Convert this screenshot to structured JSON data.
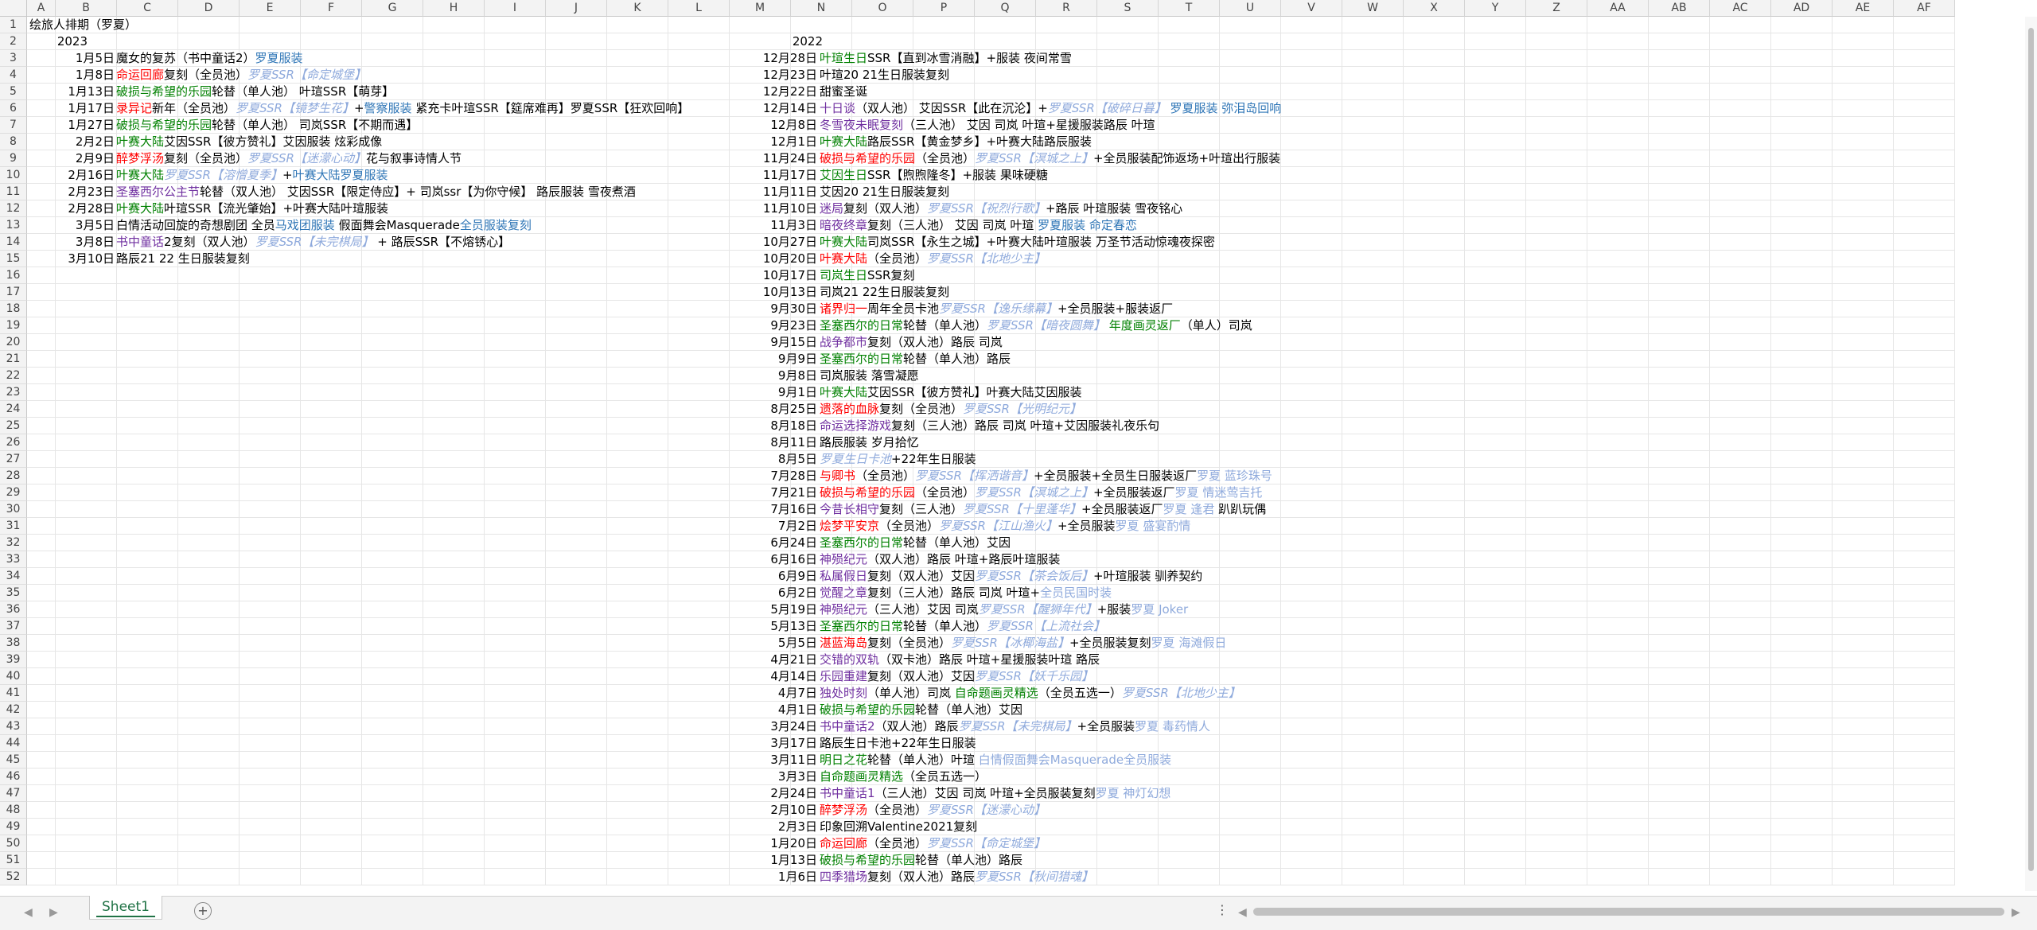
{
  "columns": [
    "A",
    "B",
    "C",
    "D",
    "E",
    "F",
    "G",
    "H",
    "I",
    "J",
    "K",
    "L",
    "M",
    "N",
    "O",
    "P",
    "Q",
    "R",
    "S",
    "T",
    "U",
    "V",
    "W",
    "X",
    "Y",
    "Z",
    "AA",
    "AB",
    "AC",
    "AD",
    "AE",
    "AF"
  ],
  "sheet_tab": "Sheet1",
  "add_sheet": "+",
  "more": "⋮",
  "colors": {
    "red": "#ff0000",
    "green": "#008000",
    "purple": "#7030a0",
    "blue": "#2e75b6",
    "lightblue": "#8faadc",
    "black": "#000000"
  },
  "title": [
    {
      "t": "绘旅人排期（罗夏）",
      "c": "black"
    }
  ],
  "left_year": "2023",
  "right_year": "2022",
  "left": [
    {
      "row": 3,
      "date": "1月5日",
      "segs": [
        {
          "t": "魔女的复苏（书中童话2）",
          "c": "black"
        },
        {
          "t": "罗夏服装",
          "c": "blue"
        }
      ]
    },
    {
      "row": 4,
      "date": "1月8日",
      "segs": [
        {
          "t": "命运回廊",
          "c": "red"
        },
        {
          "t": "复刻（全员池）",
          "c": "black"
        },
        {
          "t": "罗夏SSR【命定城堡】",
          "c": "lightblue",
          "i": true
        }
      ]
    },
    {
      "row": 5,
      "date": "1月13日",
      "segs": [
        {
          "t": "破损与希望的乐园",
          "c": "green"
        },
        {
          "t": "轮替（单人池） 叶瑄SSR【萌芽】",
          "c": "black"
        }
      ]
    },
    {
      "row": 6,
      "date": "1月17日",
      "segs": [
        {
          "t": "录异记",
          "c": "red"
        },
        {
          "t": "新年（全员池）",
          "c": "black"
        },
        {
          "t": "罗夏SSR【镜梦生花】",
          "c": "lightblue",
          "i": true
        },
        {
          "t": "+",
          "c": "black"
        },
        {
          "t": "警察服装",
          "c": "blue"
        },
        {
          "t": "    紧充卡叶瑄SSR【筵席难再】罗夏SSR【狂欢回响】",
          "c": "black"
        }
      ]
    },
    {
      "row": 7,
      "date": "1月27日",
      "segs": [
        {
          "t": "破损与希望的乐园",
          "c": "green"
        },
        {
          "t": "轮替（单人池） 司岚SSR【不期而遇】",
          "c": "black"
        }
      ]
    },
    {
      "row": 8,
      "date": "2月2日",
      "segs": [
        {
          "t": "叶赛大陆",
          "c": "green"
        },
        {
          "t": "艾因SSR【彼方赞礼】艾因服装 炫彩成像",
          "c": "black"
        }
      ]
    },
    {
      "row": 9,
      "date": "2月9日",
      "segs": [
        {
          "t": "醉梦浮汤",
          "c": "red"
        },
        {
          "t": "复刻（全员池）",
          "c": "black"
        },
        {
          "t": "罗夏SSR【迷濛心动】",
          "c": "lightblue",
          "i": true
        },
        {
          "t": "花与叙事诗情人节",
          "c": "black"
        }
      ]
    },
    {
      "row": 10,
      "date": "2月16日",
      "segs": [
        {
          "t": "叶赛大陆",
          "c": "green"
        },
        {
          "t": "罗夏SSR【溶憎夏季】",
          "c": "lightblue",
          "i": true
        },
        {
          "t": "+",
          "c": "black"
        },
        {
          "t": "叶赛大陆罗夏服装",
          "c": "blue"
        }
      ]
    },
    {
      "row": 11,
      "date": "2月23日",
      "segs": [
        {
          "t": "圣塞西尔公主节",
          "c": "purple"
        },
        {
          "t": "轮替（双人池） 艾因SSR【限定侍应】+ 司岚ssr【为你守候】  路辰服装 雪夜煮酒",
          "c": "black"
        }
      ]
    },
    {
      "row": 12,
      "date": "2月28日",
      "segs": [
        {
          "t": "叶赛大陆",
          "c": "green"
        },
        {
          "t": "叶瑄SSR【流光肇始】+叶赛大陆叶瑄服装",
          "c": "black"
        }
      ]
    },
    {
      "row": 13,
      "date": "3月5日",
      "segs": [
        {
          "t": "白情活动回旋的奇想剧团 全员",
          "c": "black"
        },
        {
          "t": "马戏团服装",
          "c": "blue"
        },
        {
          "t": "  假面舞会Masquerade",
          "c": "black"
        },
        {
          "t": "全员服装复刻",
          "c": "blue"
        }
      ]
    },
    {
      "row": 14,
      "date": "3月8日",
      "segs": [
        {
          "t": "书中童话",
          "c": "purple"
        },
        {
          "t": "2复刻（双人池）",
          "c": "black"
        },
        {
          "t": "罗夏SSR【未完棋局】",
          "c": "lightblue",
          "i": true
        },
        {
          "t": " + 路辰SSR【不熔锈心】",
          "c": "black"
        }
      ]
    },
    {
      "row": 15,
      "date": "3月10日",
      "segs": [
        {
          "t": "路辰21 22 生日服装复刻",
          "c": "black"
        }
      ]
    }
  ],
  "right": [
    {
      "row": 3,
      "date": "12月28日",
      "segs": [
        {
          "t": "叶瑄生日",
          "c": "green"
        },
        {
          "t": "SSR【直到冰雪消融】+服装 夜间常雪",
          "c": "black"
        }
      ]
    },
    {
      "row": 4,
      "date": "12月23日",
      "segs": [
        {
          "t": "叶瑄20 21生日服装复刻",
          "c": "black"
        }
      ]
    },
    {
      "row": 5,
      "date": "12月22日",
      "segs": [
        {
          "t": "甜蜜圣诞",
          "c": "black"
        }
      ]
    },
    {
      "row": 6,
      "date": "12月14日",
      "segs": [
        {
          "t": "十日谈",
          "c": "purple"
        },
        {
          "t": "（双人池） 艾因SSR【此在沉沦】+",
          "c": "black"
        },
        {
          "t": "罗夏SSR【破碎日暮】",
          "c": "lightblue",
          "i": true
        },
        {
          "t": "  罗夏服装 弥泪岛回响",
          "c": "blue"
        }
      ]
    },
    {
      "row": 7,
      "date": "12月8日",
      "segs": [
        {
          "t": "冬雪夜未眠复刻",
          "c": "purple"
        },
        {
          "t": "（三人池） 艾因 司岚 叶瑄+星援服装路辰 叶瑄",
          "c": "black"
        }
      ]
    },
    {
      "row": 8,
      "date": "12月1日",
      "segs": [
        {
          "t": "叶赛大陆",
          "c": "green"
        },
        {
          "t": "路辰SSR【黄金梦乡】+叶赛大陆路辰服装",
          "c": "black"
        }
      ]
    },
    {
      "row": 9,
      "date": "11月24日",
      "segs": [
        {
          "t": "破损与希望的乐园",
          "c": "red"
        },
        {
          "t": "（全员池）",
          "c": "black"
        },
        {
          "t": "罗夏SSR【溟城之上】",
          "c": "lightblue",
          "i": true
        },
        {
          "t": "+全员服装配饰返场+叶瑄出行服装",
          "c": "black"
        }
      ]
    },
    {
      "row": 10,
      "date": "11月17日",
      "segs": [
        {
          "t": "艾因生日",
          "c": "green"
        },
        {
          "t": "SSR【煦煦隆冬】+服装 果味硬糖",
          "c": "black"
        }
      ]
    },
    {
      "row": 11,
      "date": "11月11日",
      "segs": [
        {
          "t": "艾因20 21生日服装复刻",
          "c": "black"
        }
      ]
    },
    {
      "row": 12,
      "date": "11月10日",
      "segs": [
        {
          "t": "迷局",
          "c": "purple"
        },
        {
          "t": "复刻（双人池）",
          "c": "black"
        },
        {
          "t": "罗夏SSR【祝烈行歌】",
          "c": "lightblue",
          "i": true
        },
        {
          "t": "+路辰  叶瑄服装 雪夜铭心",
          "c": "black"
        }
      ]
    },
    {
      "row": 13,
      "date": "11月3日",
      "segs": [
        {
          "t": "暗夜终章",
          "c": "purple"
        },
        {
          "t": "复刻（三人池） 艾因 司岚 叶瑄  ",
          "c": "black"
        },
        {
          "t": "罗夏服装 命定春恋",
          "c": "blue"
        }
      ]
    },
    {
      "row": 14,
      "date": "10月27日",
      "segs": [
        {
          "t": "叶赛大陆",
          "c": "green"
        },
        {
          "t": "司岚SSR【永生之城】+叶赛大陆叶瑄服装 万圣节活动惊魂夜探密",
          "c": "black"
        }
      ]
    },
    {
      "row": 15,
      "date": "10月20日",
      "segs": [
        {
          "t": "叶赛大陆",
          "c": "red"
        },
        {
          "t": "（全员池）",
          "c": "black"
        },
        {
          "t": "罗夏SSR【北地少主】",
          "c": "lightblue",
          "i": true
        }
      ]
    },
    {
      "row": 16,
      "date": "10月17日",
      "segs": [
        {
          "t": "司岚生日",
          "c": "green"
        },
        {
          "t": "SSR复刻",
          "c": "black"
        }
      ]
    },
    {
      "row": 17,
      "date": "10月13日",
      "segs": [
        {
          "t": "司岚21 22生日服装复刻",
          "c": "black"
        }
      ]
    },
    {
      "row": 18,
      "date": "9月30日",
      "segs": [
        {
          "t": "诸界归一",
          "c": "red"
        },
        {
          "t": "周年全员卡池",
          "c": "black"
        },
        {
          "t": "罗夏SSR【逸乐缘幕】",
          "c": "lightblue",
          "i": true
        },
        {
          "t": "+全员服装+服装返厂",
          "c": "black"
        }
      ]
    },
    {
      "row": 19,
      "date": "9月23日",
      "segs": [
        {
          "t": "圣塞西尔的日常",
          "c": "green"
        },
        {
          "t": "轮替（单人池）",
          "c": "black"
        },
        {
          "t": "罗夏SSR【暗夜圆舞】",
          "c": "lightblue",
          "i": true
        },
        {
          "t": "  年度画灵返厂",
          "c": "green"
        },
        {
          "t": "（单人）司岚",
          "c": "black"
        }
      ]
    },
    {
      "row": 20,
      "date": "9月15日",
      "segs": [
        {
          "t": "战争都市",
          "c": "purple"
        },
        {
          "t": "复刻（双人池）路辰 司岚",
          "c": "black"
        }
      ]
    },
    {
      "row": 21,
      "date": "9月9日",
      "segs": [
        {
          "t": "圣塞西尔的日常",
          "c": "green"
        },
        {
          "t": "轮替（单人池）路辰",
          "c": "black"
        }
      ]
    },
    {
      "row": 22,
      "date": "9月8日",
      "segs": [
        {
          "t": "司岚服装 落雪凝愿",
          "c": "black"
        }
      ]
    },
    {
      "row": 23,
      "date": "9月1日",
      "segs": [
        {
          "t": "叶赛大陆",
          "c": "green"
        },
        {
          "t": "艾因SSR【彼方赞礼】叶赛大陆艾因服装",
          "c": "black"
        }
      ]
    },
    {
      "row": 24,
      "date": "8月25日",
      "segs": [
        {
          "t": "遗落的血脉",
          "c": "red"
        },
        {
          "t": "复刻（全员池）",
          "c": "black"
        },
        {
          "t": "罗夏SSR【光明纪元】",
          "c": "lightblue",
          "i": true
        }
      ]
    },
    {
      "row": 25,
      "date": "8月18日",
      "segs": [
        {
          "t": "命运选择游戏",
          "c": "purple"
        },
        {
          "t": "复刻（三人池）路辰 司岚 叶瑄+艾因服装礼夜乐句",
          "c": "black"
        }
      ]
    },
    {
      "row": 26,
      "date": "8月11日",
      "segs": [
        {
          "t": "路辰服装 岁月拾忆",
          "c": "black"
        }
      ]
    },
    {
      "row": 27,
      "date": "8月5日",
      "segs": [
        {
          "t": "罗夏生日卡池",
          "c": "lightblue",
          "i": true
        },
        {
          "t": "+22年生日服装",
          "c": "black"
        }
      ]
    },
    {
      "row": 28,
      "date": "7月28日",
      "segs": [
        {
          "t": "与卿书",
          "c": "red"
        },
        {
          "t": "（全员池）",
          "c": "black"
        },
        {
          "t": "罗夏SSR【挥洒谐音】",
          "c": "lightblue",
          "i": true
        },
        {
          "t": "+全员服装+全员生日服装返厂",
          "c": "black"
        },
        {
          "t": "罗夏 蓝珍珠号",
          "c": "lightblue"
        }
      ]
    },
    {
      "row": 29,
      "date": "7月21日",
      "segs": [
        {
          "t": "破损与希望的乐园",
          "c": "red"
        },
        {
          "t": "（全员池）",
          "c": "black"
        },
        {
          "t": "罗夏SSR【溟城之上】",
          "c": "lightblue",
          "i": true
        },
        {
          "t": "+全员服装返厂",
          "c": "black"
        },
        {
          "t": "罗夏 情迷莺吉托",
          "c": "lightblue"
        }
      ]
    },
    {
      "row": 30,
      "date": "7月16日",
      "segs": [
        {
          "t": "今昔长相守",
          "c": "purple"
        },
        {
          "t": "复刻（三人池）",
          "c": "black"
        },
        {
          "t": "罗夏SSR【十里蓬华】",
          "c": "lightblue",
          "i": true
        },
        {
          "t": "+全员服装返厂",
          "c": "black"
        },
        {
          "t": "罗夏 逢君",
          "c": "lightblue"
        },
        {
          "t": " 趴趴玩偶",
          "c": "black"
        }
      ]
    },
    {
      "row": 31,
      "date": "7月2日",
      "segs": [
        {
          "t": "烩梦平安京",
          "c": "red"
        },
        {
          "t": "（全员池）",
          "c": "black"
        },
        {
          "t": "罗夏SSR【江山渔火】",
          "c": "lightblue",
          "i": true
        },
        {
          "t": "+全员服装",
          "c": "black"
        },
        {
          "t": "罗夏 盛宴酌情",
          "c": "lightblue"
        }
      ]
    },
    {
      "row": 32,
      "date": "6月24日",
      "segs": [
        {
          "t": "圣塞西尔的日常",
          "c": "green"
        },
        {
          "t": "轮替（单人池）艾因",
          "c": "black"
        }
      ]
    },
    {
      "row": 33,
      "date": "6月16日",
      "segs": [
        {
          "t": "神殒纪元",
          "c": "purple"
        },
        {
          "t": "（双人池）路辰 叶瑄+路辰叶瑄服装",
          "c": "black"
        }
      ]
    },
    {
      "row": 34,
      "date": "6月9日",
      "segs": [
        {
          "t": "私属假日",
          "c": "purple"
        },
        {
          "t": "复刻（双人池）艾因",
          "c": "black"
        },
        {
          "t": "罗夏SSR【茶会饭后】",
          "c": "lightblue",
          "i": true
        },
        {
          "t": "+叶瑄服装 驯养契约",
          "c": "black"
        }
      ]
    },
    {
      "row": 35,
      "date": "6月2日",
      "segs": [
        {
          "t": "觉醒之章",
          "c": "purple"
        },
        {
          "t": "复刻（三人池）路辰 司岚 叶瑄+",
          "c": "black"
        },
        {
          "t": "全员民国时装",
          "c": "lightblue"
        }
      ]
    },
    {
      "row": 36,
      "date": "5月19日",
      "segs": [
        {
          "t": "神殒纪元",
          "c": "purple"
        },
        {
          "t": "（三人池）艾因 司岚",
          "c": "black"
        },
        {
          "t": "罗夏SSR【醒狮年代】",
          "c": "lightblue",
          "i": true
        },
        {
          "t": "+服装",
          "c": "black"
        },
        {
          "t": "罗夏 Joker",
          "c": "lightblue"
        }
      ]
    },
    {
      "row": 37,
      "date": "5月13日",
      "segs": [
        {
          "t": "圣塞西尔的日常",
          "c": "green"
        },
        {
          "t": "轮替（单人池）",
          "c": "black"
        },
        {
          "t": "罗夏SSR【上流社会】",
          "c": "lightblue",
          "i": true
        }
      ]
    },
    {
      "row": 38,
      "date": "5月5日",
      "segs": [
        {
          "t": "湛蓝海岛",
          "c": "red"
        },
        {
          "t": "复刻（全员池）",
          "c": "black"
        },
        {
          "t": "罗夏SSR【冰椰海盐】",
          "c": "lightblue",
          "i": true
        },
        {
          "t": "+全员服装复刻",
          "c": "black"
        },
        {
          "t": "罗夏 海滩假日",
          "c": "lightblue"
        }
      ]
    },
    {
      "row": 39,
      "date": "4月21日",
      "segs": [
        {
          "t": "交错的双轨",
          "c": "purple"
        },
        {
          "t": "（双卡池）路辰 叶瑄+星援服装叶瑄 路辰",
          "c": "black"
        }
      ]
    },
    {
      "row": 40,
      "date": "4月14日",
      "segs": [
        {
          "t": "乐园重建",
          "c": "purple"
        },
        {
          "t": "复刻（双人池）艾因",
          "c": "black"
        },
        {
          "t": "罗夏SSR【妖千乐园】",
          "c": "lightblue",
          "i": true
        }
      ]
    },
    {
      "row": 41,
      "date": "4月7日",
      "segs": [
        {
          "t": "独处时刻",
          "c": "purple"
        },
        {
          "t": "（单人池）司岚 ",
          "c": "black"
        },
        {
          "t": "自命题画灵精选",
          "c": "green"
        },
        {
          "t": "（全员五选一）",
          "c": "black"
        },
        {
          "t": "罗夏SSR【北地少主】",
          "c": "lightblue",
          "i": true
        }
      ]
    },
    {
      "row": 42,
      "date": "4月1日",
      "segs": [
        {
          "t": "破损与希望的乐园",
          "c": "green"
        },
        {
          "t": "轮替（单人池）艾因",
          "c": "black"
        }
      ]
    },
    {
      "row": 43,
      "date": "3月24日",
      "segs": [
        {
          "t": "书中童话2",
          "c": "purple"
        },
        {
          "t": "（双人池）路辰",
          "c": "black"
        },
        {
          "t": "罗夏SSR【未完棋局】",
          "c": "lightblue",
          "i": true
        },
        {
          "t": "+全员服装",
          "c": "black"
        },
        {
          "t": "罗夏 毒药情人",
          "c": "lightblue"
        }
      ]
    },
    {
      "row": 44,
      "date": "3月17日",
      "segs": [
        {
          "t": "路辰生日卡池+22年生日服装",
          "c": "black"
        }
      ]
    },
    {
      "row": 45,
      "date": "3月11日",
      "segs": [
        {
          "t": "明日之花",
          "c": "green"
        },
        {
          "t": "轮替（单人池）叶瑄  ",
          "c": "black"
        },
        {
          "t": "白情假面舞会Masquerade全员服装",
          "c": "lightblue"
        }
      ]
    },
    {
      "row": 46,
      "date": "3月3日",
      "segs": [
        {
          "t": "自命题画灵精选",
          "c": "green"
        },
        {
          "t": "（全员五选一）",
          "c": "black"
        }
      ]
    },
    {
      "row": 47,
      "date": "2月24日",
      "segs": [
        {
          "t": "书中童话1",
          "c": "purple"
        },
        {
          "t": "（三人池）艾因 司岚 叶瑄+全员服装复刻",
          "c": "black"
        },
        {
          "t": "罗夏 神灯幻想",
          "c": "lightblue"
        }
      ]
    },
    {
      "row": 48,
      "date": "2月10日",
      "segs": [
        {
          "t": "醉梦浮汤",
          "c": "red"
        },
        {
          "t": "（全员池）",
          "c": "black"
        },
        {
          "t": "罗夏SSR【迷濛心动】",
          "c": "lightblue",
          "i": true
        }
      ]
    },
    {
      "row": 49,
      "date": "2月3日",
      "segs": [
        {
          "t": "印象回溯Valentine2021复刻",
          "c": "black"
        }
      ]
    },
    {
      "row": 50,
      "date": "1月20日",
      "segs": [
        {
          "t": "命运回廊",
          "c": "red"
        },
        {
          "t": "（全员池）",
          "c": "black"
        },
        {
          "t": "罗夏SSR【命定城堡】",
          "c": "lightblue",
          "i": true
        }
      ]
    },
    {
      "row": 51,
      "date": "1月13日",
      "segs": [
        {
          "t": "破损与希望的乐园",
          "c": "green"
        },
        {
          "t": "轮替（单人池）路辰",
          "c": "black"
        }
      ]
    },
    {
      "row": 52,
      "date": "1月6日",
      "segs": [
        {
          "t": "四季猎场",
          "c": "purple"
        },
        {
          "t": "复刻（双人池）路辰",
          "c": "black"
        },
        {
          "t": "罗夏SSR【秋间猎魂】",
          "c": "lightblue",
          "i": true
        }
      ]
    }
  ]
}
